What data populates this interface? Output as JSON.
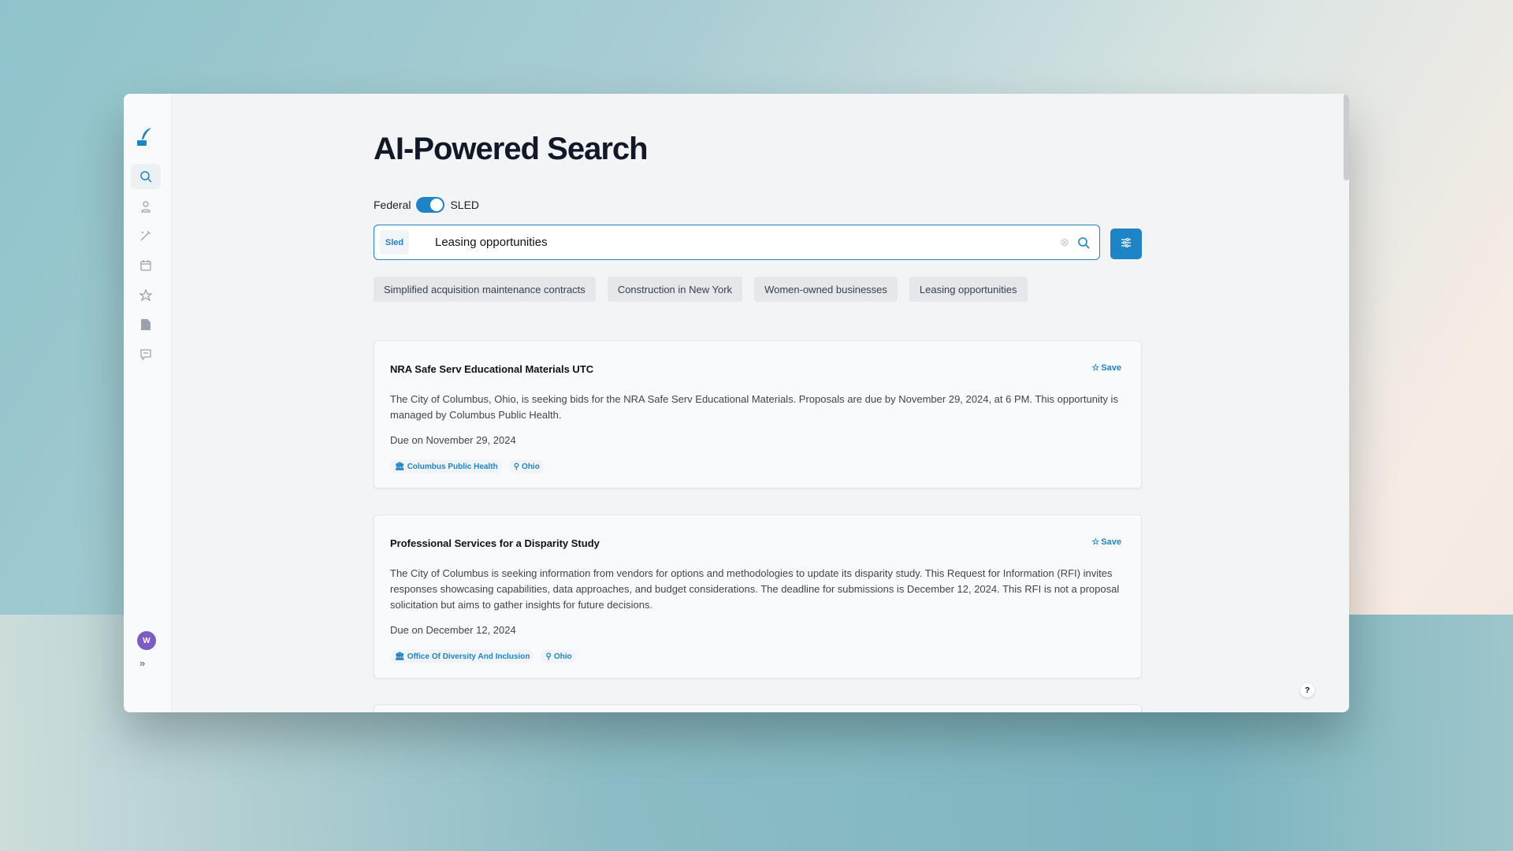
{
  "page": {
    "title": "AI-Powered Search"
  },
  "toggle": {
    "left_label": "Federal",
    "right_label": "SLED",
    "selected": "SLED"
  },
  "search": {
    "tag": "Sled",
    "value": "Leasing opportunities"
  },
  "suggestions": [
    "Simplified acquisition maintenance contracts",
    "Construction in New York",
    "Women-owned businesses",
    "Leasing opportunities"
  ],
  "results": [
    {
      "title": "NRA Safe Serv Educational Materials UTC",
      "save_label": "Save",
      "description": "The City of Columbus, Ohio, is seeking bids for the NRA Safe Serv Educational Materials. Proposals are due by November 29, 2024, at 6 PM. This opportunity is managed by Columbus Public Health.",
      "due": "Due on November 29, 2024",
      "agency": "Columbus Public Health",
      "location": "Ohio"
    },
    {
      "title": "Professional Services for a Disparity Study",
      "save_label": "Save",
      "description": "The City of Columbus is seeking information from vendors for options and methodologies to update its disparity study. This Request for Information (RFI) invites responses showcasing capabilities, data approaches, and budget considerations. The deadline for submissions is December 12, 2024. This RFI is not a proposal solicitation but aims to gather insights for future decisions.",
      "due": "Due on December 12, 2024",
      "agency": "Office Of Diversity And Inclusion",
      "location": "Ohio"
    }
  ],
  "user": {
    "avatar_initial": "W"
  },
  "help": "?",
  "colors": {
    "accent": "#1f84c6",
    "avatar": "#7c5bc4"
  }
}
